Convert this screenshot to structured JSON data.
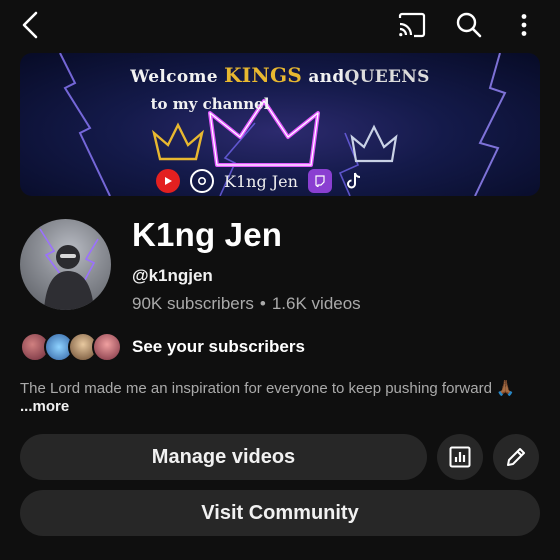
{
  "header": {
    "icons": [
      "back-arrow-icon",
      "cast-icon",
      "search-icon",
      "more-vert-icon"
    ]
  },
  "banner": {
    "line1_prefix": "Welcome ",
    "line1_kings": "KINGS",
    "line1_and": " and",
    "line1_queens": "QUEENS",
    "line2": "to my channel",
    "social_handle": "K1ng Jen"
  },
  "channel": {
    "name": "K1ng Jen",
    "handle": "@k1ngjen",
    "subscribers": "90K subscribers",
    "separator": "•",
    "videos": "1.6K videos"
  },
  "subscribers_row": {
    "label": "See your subscribers"
  },
  "description": {
    "text": "The Lord made me an inspiration for everyone to keep pushing forward 🙏🏾",
    "more": " ...more"
  },
  "actions": {
    "manage_videos": "Manage videos",
    "visit_community": "Visit Community"
  },
  "colors": {
    "background": "#0f0f0f",
    "button_bg": "#272727",
    "secondary_text": "#aaaaaa",
    "accent_gold": "#e8b830"
  }
}
